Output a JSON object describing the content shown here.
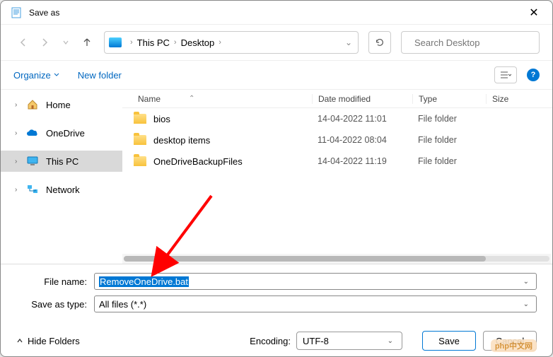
{
  "title": "Save as",
  "breadcrumb": {
    "root": "This PC",
    "folder": "Desktop"
  },
  "search": {
    "placeholder": "Search Desktop"
  },
  "toolbar": {
    "organize": "Organize",
    "new_folder": "New folder"
  },
  "sidebar": {
    "home": "Home",
    "onedrive": "OneDrive",
    "thispc": "This PC",
    "network": "Network"
  },
  "columns": {
    "name": "Name",
    "date": "Date modified",
    "type": "Type",
    "size": "Size"
  },
  "files": [
    {
      "name": "bios",
      "date": "14-04-2022 11:01",
      "type": "File folder"
    },
    {
      "name": "desktop items",
      "date": "11-04-2022 08:04",
      "type": "File folder"
    },
    {
      "name": "OneDriveBackupFiles",
      "date": "14-04-2022 11:19",
      "type": "File folder"
    }
  ],
  "form": {
    "filename_label": "File name:",
    "filename_value": "RemoveOneDrive.bat",
    "savetype_label": "Save as type:",
    "savetype_value": "All files  (*.*)"
  },
  "footer": {
    "hide_folders": "Hide Folders",
    "encoding_label": "Encoding:",
    "encoding_value": "UTF-8",
    "save": "Save",
    "cancel": "Cancel"
  },
  "watermark": "php中文网"
}
